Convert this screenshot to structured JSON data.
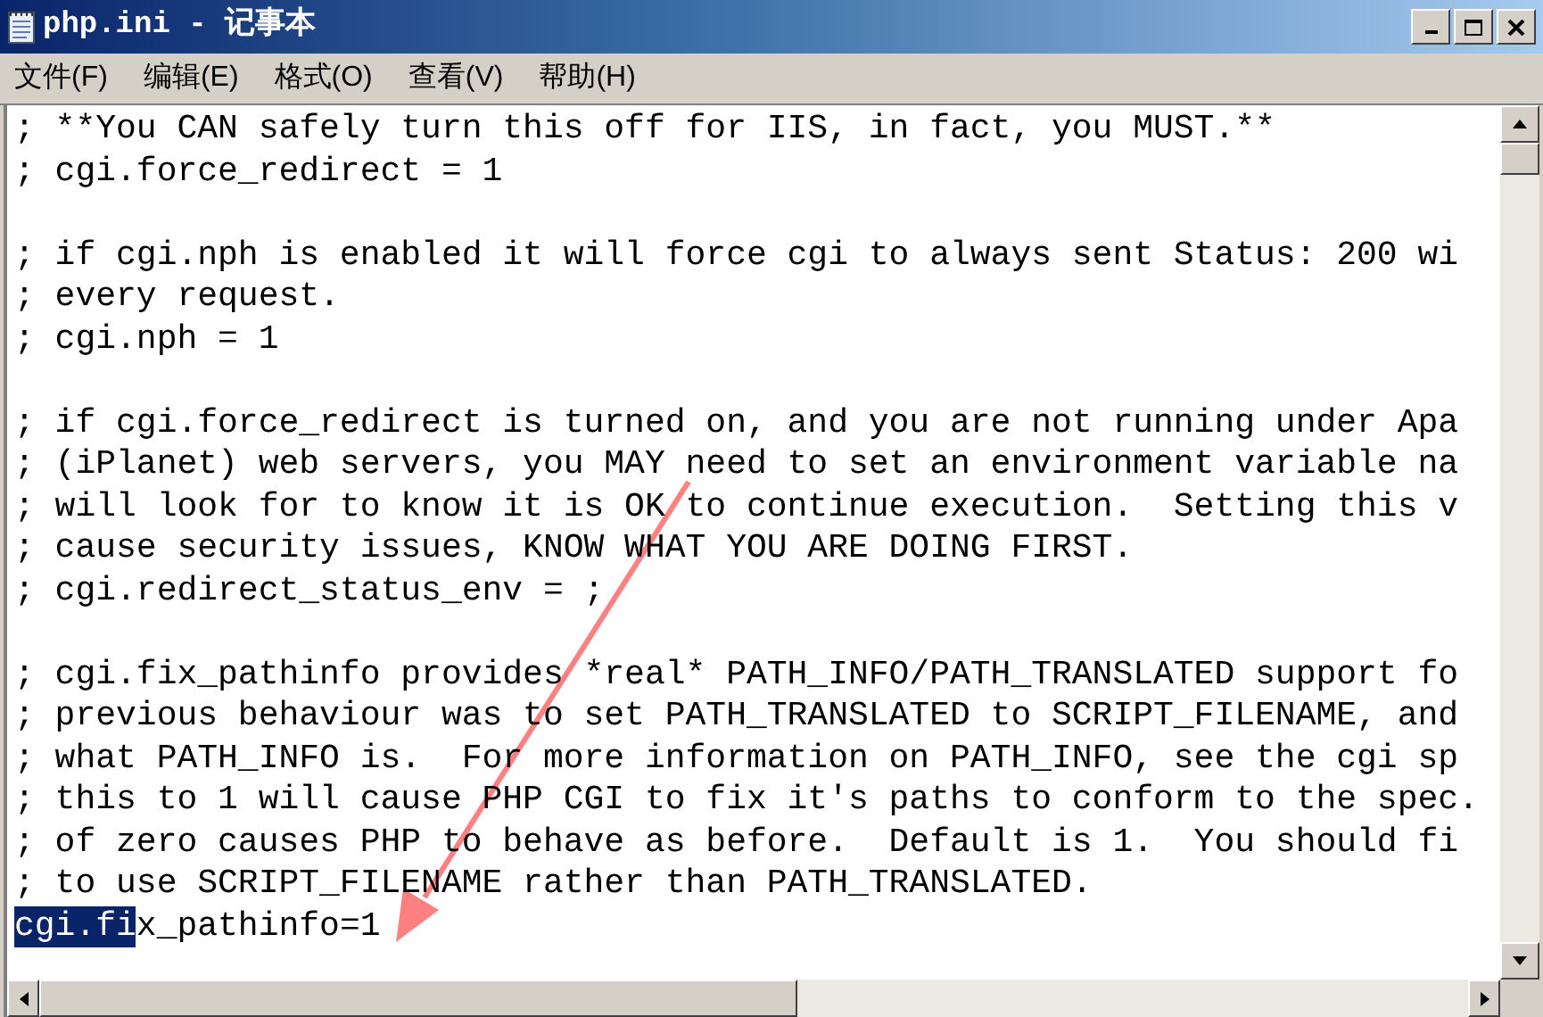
{
  "window": {
    "title": "php.ini - 记事本"
  },
  "menu": [
    {
      "label": "文件(F)"
    },
    {
      "label": "编辑(E)"
    },
    {
      "label": "格式(O)"
    },
    {
      "label": "查看(V)"
    },
    {
      "label": "帮助(H)"
    }
  ],
  "editor": {
    "lines": [
      {
        "kind": "text",
        "text": "; **You CAN safely turn this off for IIS, in fact, you MUST.**"
      },
      {
        "kind": "text",
        "text": "; cgi.force_redirect = 1"
      },
      {
        "kind": "blank"
      },
      {
        "kind": "text",
        "text": "; if cgi.nph is enabled it will force cgi to always sent Status: 200 wi"
      },
      {
        "kind": "text",
        "text": "; every request."
      },
      {
        "kind": "text",
        "text": "; cgi.nph = 1"
      },
      {
        "kind": "blank"
      },
      {
        "kind": "text",
        "text": "; if cgi.force_redirect is turned on, and you are not running under Apa"
      },
      {
        "kind": "text",
        "text": "; (iPlanet) web servers, you MAY need to set an environment variable na"
      },
      {
        "kind": "text",
        "text": "; will look for to know it is OK to continue execution.  Setting this v"
      },
      {
        "kind": "text",
        "text": "; cause security issues, KNOW WHAT YOU ARE DOING FIRST."
      },
      {
        "kind": "text",
        "text": "; cgi.redirect_status_env = ;"
      },
      {
        "kind": "blank"
      },
      {
        "kind": "text",
        "text": "; cgi.fix_pathinfo provides *real* PATH_INFO/PATH_TRANSLATED support fo"
      },
      {
        "kind": "text",
        "text": "; previous behaviour was to set PATH_TRANSLATED to SCRIPT_FILENAME, and"
      },
      {
        "kind": "text",
        "text": "; what PATH_INFO is.  For more information on PATH_INFO, see the cgi sp"
      },
      {
        "kind": "text",
        "text": "; this to 1 will cause PHP CGI to fix it's paths to conform to the spec."
      },
      {
        "kind": "text",
        "text": "; of zero causes PHP to behave as before.  Default is 1.  You should fi"
      },
      {
        "kind": "text",
        "text": "; to use SCRIPT_FILENAME rather than PATH_TRANSLATED."
      },
      {
        "kind": "selection",
        "segments": [
          {
            "text": "cgi.fi",
            "selected": true
          },
          {
            "text": "x_pathinfo=1",
            "selected": false
          }
        ]
      }
    ]
  }
}
